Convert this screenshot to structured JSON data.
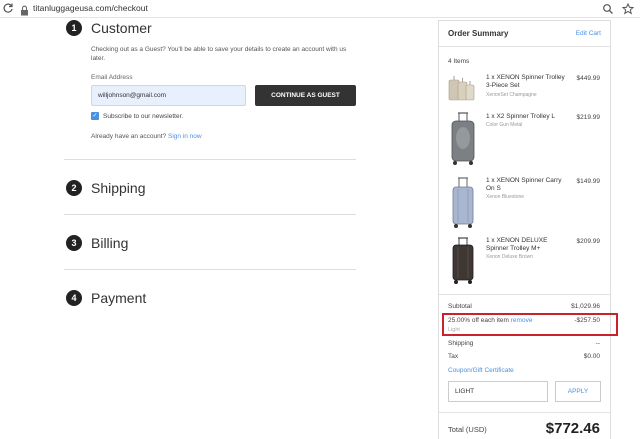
{
  "browser": {
    "url": "titanluggageusa.com/checkout"
  },
  "checkout": {
    "steps": [
      {
        "number": "1",
        "title": "Customer"
      },
      {
        "number": "2",
        "title": "Shipping"
      },
      {
        "number": "3",
        "title": "Billing"
      },
      {
        "number": "4",
        "title": "Payment"
      }
    ],
    "customer": {
      "guest_text": "Checking out as a Guest? You'll be able to save your details to create an account with us later.",
      "email_label": "Email Address",
      "email_value": "willjohnson@gmail.com",
      "continue_label": "CONTINUE AS GUEST",
      "newsletter_label": "Subscribe to our newsletter.",
      "newsletter_checked": true,
      "account_prefix": "Already have an account?",
      "signin_label": "Sign in now"
    }
  },
  "summary": {
    "title": "Order Summary",
    "edit_label": "Edit Cart",
    "items_count": "4 Items",
    "items": [
      {
        "name": "1 x XENON Spinner Trolley 3-Piece Set",
        "variant": "XenonSet Champagne",
        "price": "$449.99"
      },
      {
        "name": "1 x X2 Spinner Trolley L",
        "variant": "Color Gun Metal",
        "price": "$219.99"
      },
      {
        "name": "1 x XENON Spinner Carry On S",
        "variant": "Xenon Bluestone",
        "price": "$149.99"
      },
      {
        "name": "1 x XENON DELUXE Spinner Trolley M+",
        "variant": "Xenon Deluxe Brown",
        "price": "$209.99"
      }
    ],
    "subtotal_label": "Subtotal",
    "subtotal_value": "$1,029.96",
    "discount_label": "25.00% off each item",
    "discount_remove": "remove",
    "discount_code": "Light",
    "discount_value": "-$257.50",
    "shipping_label": "Shipping",
    "shipping_value": "--",
    "tax_label": "Tax",
    "tax_value": "$0.00",
    "coupon_label": "Coupon/Gift Certificate",
    "coupon_value": "LIGHT",
    "apply_label": "APPLY",
    "total_label": "Total (USD)",
    "total_value": "$772.46"
  },
  "colors": {
    "accent_link": "#4a90e2",
    "button_dark": "#333333",
    "highlight_box": "#c8232c"
  }
}
